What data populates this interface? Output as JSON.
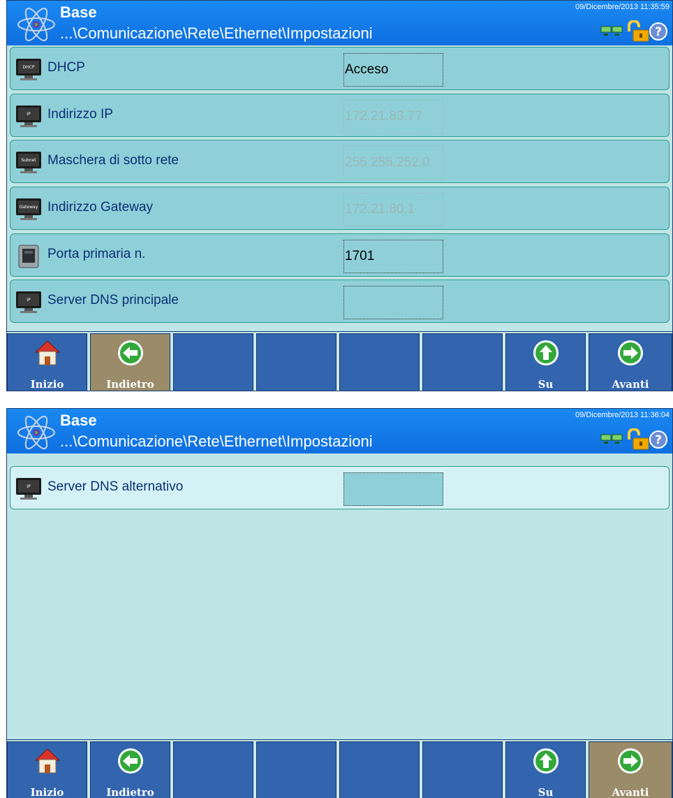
{
  "screens": [
    {
      "header": {
        "title": "Base",
        "breadcrumb": "...\\Comunicazione\\Rete\\Ethernet\\Impostazioni",
        "datetime": "09/Dicembre/2013 11:35:59",
        "status_icons": [
          "network-icon",
          "lock-open-icon",
          "help-icon"
        ]
      },
      "rows": [
        {
          "label": "DHCP",
          "value": "Acceso",
          "icon": "dhcp-monitor-icon",
          "icon_text": "DHCP"
        },
        {
          "label": "Indirizzo IP",
          "value": "172.21.83.77",
          "icon": "ip-monitor-icon",
          "icon_text": "IP"
        },
        {
          "label": "Maschera di sotto rete",
          "value": "255.255.252.0",
          "icon": "subnet-monitor-icon",
          "icon_text": "Subnet"
        },
        {
          "label": "Indirizzo Gateway",
          "value": "172.21.80.1",
          "icon": "gateway-monitor-icon",
          "icon_text": "Gateway"
        },
        {
          "label": "Porta primaria n.",
          "value": "1701",
          "icon": "port-icon"
        },
        {
          "label": "Server DNS principale",
          "value": "",
          "icon": "dns-monitor-icon",
          "icon_text": "IP"
        }
      ],
      "toolbar": [
        {
          "label": "Inizio",
          "icon": "home-icon"
        },
        {
          "label": "Indietro",
          "icon": "arrow-left-icon"
        },
        {
          "label": "",
          "icon": ""
        },
        {
          "label": "",
          "icon": ""
        },
        {
          "label": "",
          "icon": ""
        },
        {
          "label": "",
          "icon": ""
        },
        {
          "label": "Su",
          "icon": "arrow-up-icon"
        },
        {
          "label": "Avanti",
          "icon": "arrow-right-icon"
        }
      ]
    },
    {
      "header": {
        "title": "Base",
        "breadcrumb": "...\\Comunicazione\\Rete\\Ethernet\\Impostazioni",
        "datetime": "09/Dicembre/2013 11:36:04",
        "status_icons": [
          "network-icon",
          "lock-open-icon",
          "help-icon"
        ]
      },
      "rows": [
        {
          "label": "Server DNS alternativo",
          "value": "",
          "icon": "dns-monitor-icon",
          "icon_text": "IP"
        }
      ],
      "toolbar": [
        {
          "label": "Inizio",
          "icon": "home-icon"
        },
        {
          "label": "Indietro",
          "icon": "arrow-left-icon"
        },
        {
          "label": "",
          "icon": ""
        },
        {
          "label": "",
          "icon": ""
        },
        {
          "label": "",
          "icon": ""
        },
        {
          "label": "",
          "icon": ""
        },
        {
          "label": "Su",
          "icon": "arrow-up-icon"
        },
        {
          "label": "Avanti",
          "icon": "arrow-right-icon"
        }
      ]
    }
  ],
  "colors": {
    "titlebar": "#1a89f2",
    "row_bg": "#8fd0d8",
    "row_selected_bg": "#d4f2f6",
    "button_bg": "#3265ad",
    "button_active_bg": "#9a8c69",
    "label_text": "#0b2f73",
    "disabled_value_text": "#99b7b5"
  }
}
